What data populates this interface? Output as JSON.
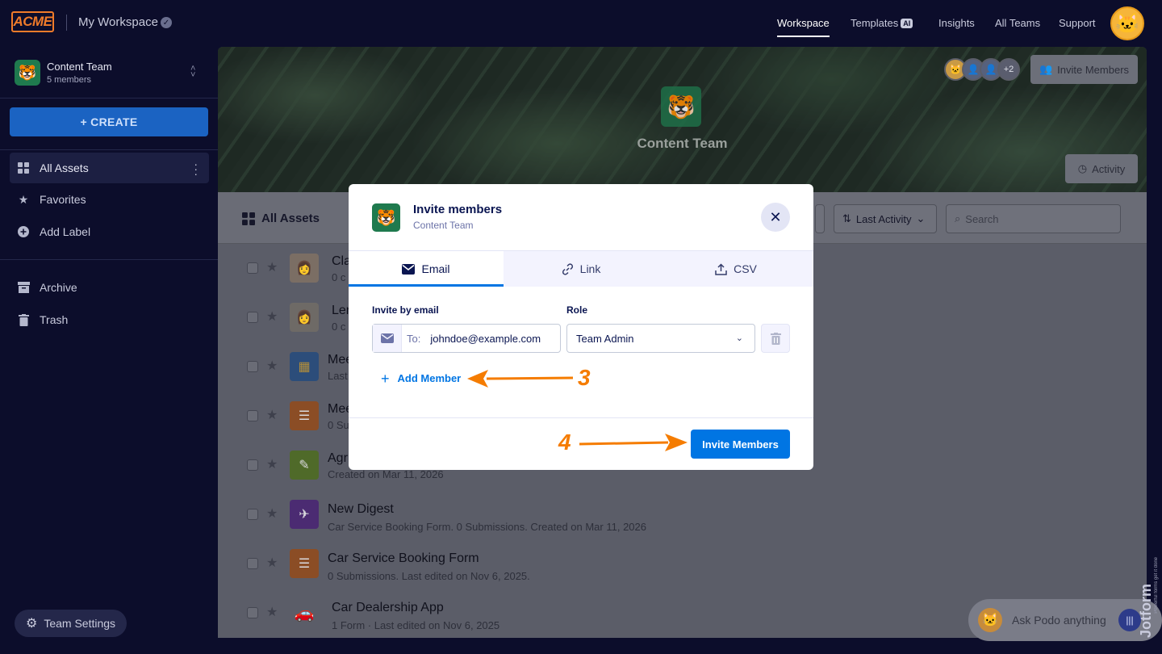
{
  "topbar": {
    "logo": "ACME",
    "workspace": "My Workspace",
    "nav": [
      "Workspace",
      "Templates",
      "Insights",
      "All Teams",
      "Support"
    ],
    "templates_badge": "AI"
  },
  "sidebar": {
    "team_name": "Content Team",
    "team_count": "5 members",
    "create_label": "+ CREATE",
    "items": [
      {
        "label": "All Assets",
        "icon": "grid-icon"
      },
      {
        "label": "Favorites",
        "icon": "star-icon"
      },
      {
        "label": "Add Label",
        "icon": "plus-circle-icon"
      },
      {
        "label": "Archive",
        "icon": "archive-icon"
      },
      {
        "label": "Trash",
        "icon": "trash-icon"
      }
    ],
    "team_settings": "Team Settings"
  },
  "hero": {
    "team_name": "Content Team",
    "extra_count": "+2",
    "invite_button": "Invite Members",
    "activity_button": "Activity"
  },
  "toolbar": {
    "title": "All Assets",
    "sort_label": "Last Activity",
    "search_placeholder": "Search"
  },
  "assets": [
    {
      "title": "Cla",
      "sub": "0 c"
    },
    {
      "title": "Ler",
      "sub": "0 c"
    },
    {
      "title": "Mee",
      "sub": "Last"
    },
    {
      "title": "Mee",
      "sub": "0 Su"
    },
    {
      "title": "Agr",
      "sub": "Created on Mar 11, 2026"
    },
    {
      "title": "New Digest",
      "sub": "Car Service Booking Form. 0 Submissions. Created on Mar 11, 2026"
    },
    {
      "title": "Car Service Booking Form",
      "sub": "0 Submissions.  Last edited on Nov 6, 2025."
    },
    {
      "title": "Car Dealership App",
      "sub": "1 Form · Last edited on Nov 6, 2025"
    }
  ],
  "podo": {
    "placeholder": "Ask Podo anything"
  },
  "jotform": {
    "brand": "Jotform",
    "tagline": "Powerful forms get it done"
  },
  "modal": {
    "title": "Invite members",
    "subtitle": "Content Team",
    "tabs": [
      "Email",
      "Link",
      "CSV"
    ],
    "invite_label": "Invite by email",
    "role_label": "Role",
    "to_label": "To:",
    "email_value": "johndoe@example.com",
    "role_value": "Team Admin",
    "add_member": "Add Member",
    "submit": "Invite Members"
  },
  "annotations": {
    "step3": "3",
    "step4": "4"
  },
  "colors": {
    "accent": "#0075e3",
    "annotation": "#f57c00",
    "background": "#0c0d2b"
  }
}
